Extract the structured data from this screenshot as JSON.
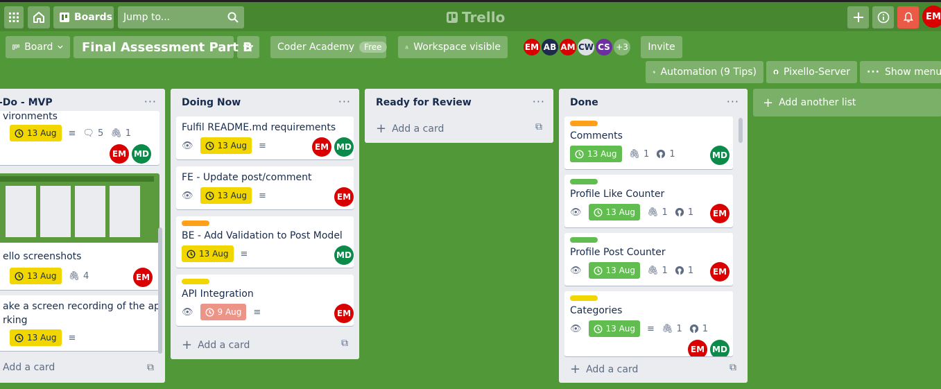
{
  "colors": {
    "board_bg": "#519839",
    "label_orange": "#ff9f1a",
    "label_green": "#61bd4f",
    "label_yellow": "#f2d600",
    "due_yellow": "#f2d600",
    "due_green": "#61bd4f",
    "due_red": "#ec9488",
    "avatar_em": "#d80000",
    "avatar_md": "#0b8a49"
  },
  "topnav": {
    "boards_label": "Boards",
    "jump_placeholder": "Jump to...",
    "logo_text": "Trello",
    "user_initials": "EM"
  },
  "header": {
    "view_label": "Board",
    "board_title": "Final Assessment Part B",
    "workspace_name": "Coder Academy",
    "workspace_plan": "Free",
    "visibility_label": "Workspace visible",
    "members": [
      {
        "initials": "EM",
        "color": "#d80000"
      },
      {
        "initials": "AB",
        "color": "#1d2c4a"
      },
      {
        "initials": "AM",
        "color": "#d80000"
      },
      {
        "initials": "CW",
        "color": "#dfe1e6"
      },
      {
        "initials": "CS",
        "color": "#6b2fa0"
      }
    ],
    "more_members": "+3",
    "invite_label": "Invite",
    "automation_label": "Automation (9 Tips)",
    "powerup_label": "Pixello-Server",
    "show_menu_label": "Show menu"
  },
  "lists": [
    {
      "title": "-Do - MVP",
      "cards": [
        {
          "title": "vironments",
          "due": "13 Aug",
          "comments": "5",
          "attachments": "1",
          "members": [
            "EM",
            "MD"
          ]
        },
        {
          "title": "ello screenshots",
          "due": "13 Aug",
          "attachments": "4",
          "members": [
            "EM"
          ]
        },
        {
          "title_line1": "ake a screen recording of the app",
          "title_line2": "rking",
          "due": "13 Aug"
        }
      ],
      "add_card": "Add a card"
    },
    {
      "title": "Doing Now",
      "cards": [
        {
          "title": "Fulfil README.md requirements",
          "due": "13 Aug",
          "members": [
            "EM",
            "MD"
          ]
        },
        {
          "title": "FE - Update post/comment",
          "due": "13 Aug",
          "members": [
            "EM"
          ]
        },
        {
          "title": "BE - Add Validation to Post Model",
          "due": "13 Aug",
          "members": [
            "MD"
          ]
        },
        {
          "title": "API Integration",
          "due": "9 Aug",
          "members": [
            "EM"
          ]
        }
      ],
      "add_card": "Add a card"
    },
    {
      "title": "Ready for Review",
      "cards": [],
      "add_card": "Add a card"
    },
    {
      "title": "Done",
      "cards": [
        {
          "title": "Comments",
          "due": "13 Aug",
          "attachments": "1",
          "github": "1",
          "members": [
            "MD"
          ]
        },
        {
          "title": "Profile Like Counter",
          "due": "13 Aug",
          "attachments": "1",
          "github": "1",
          "members": [
            "EM"
          ]
        },
        {
          "title": "Profile Post Counter",
          "due": "13 Aug",
          "attachments": "1",
          "github": "1",
          "members": [
            "EM"
          ]
        },
        {
          "title": "Categories",
          "due": "13 Aug",
          "attachments": "1",
          "github": "1",
          "members": [
            "EM",
            "MD"
          ]
        }
      ],
      "add_card": "Add a card"
    }
  ],
  "add_list_label": "Add another list"
}
